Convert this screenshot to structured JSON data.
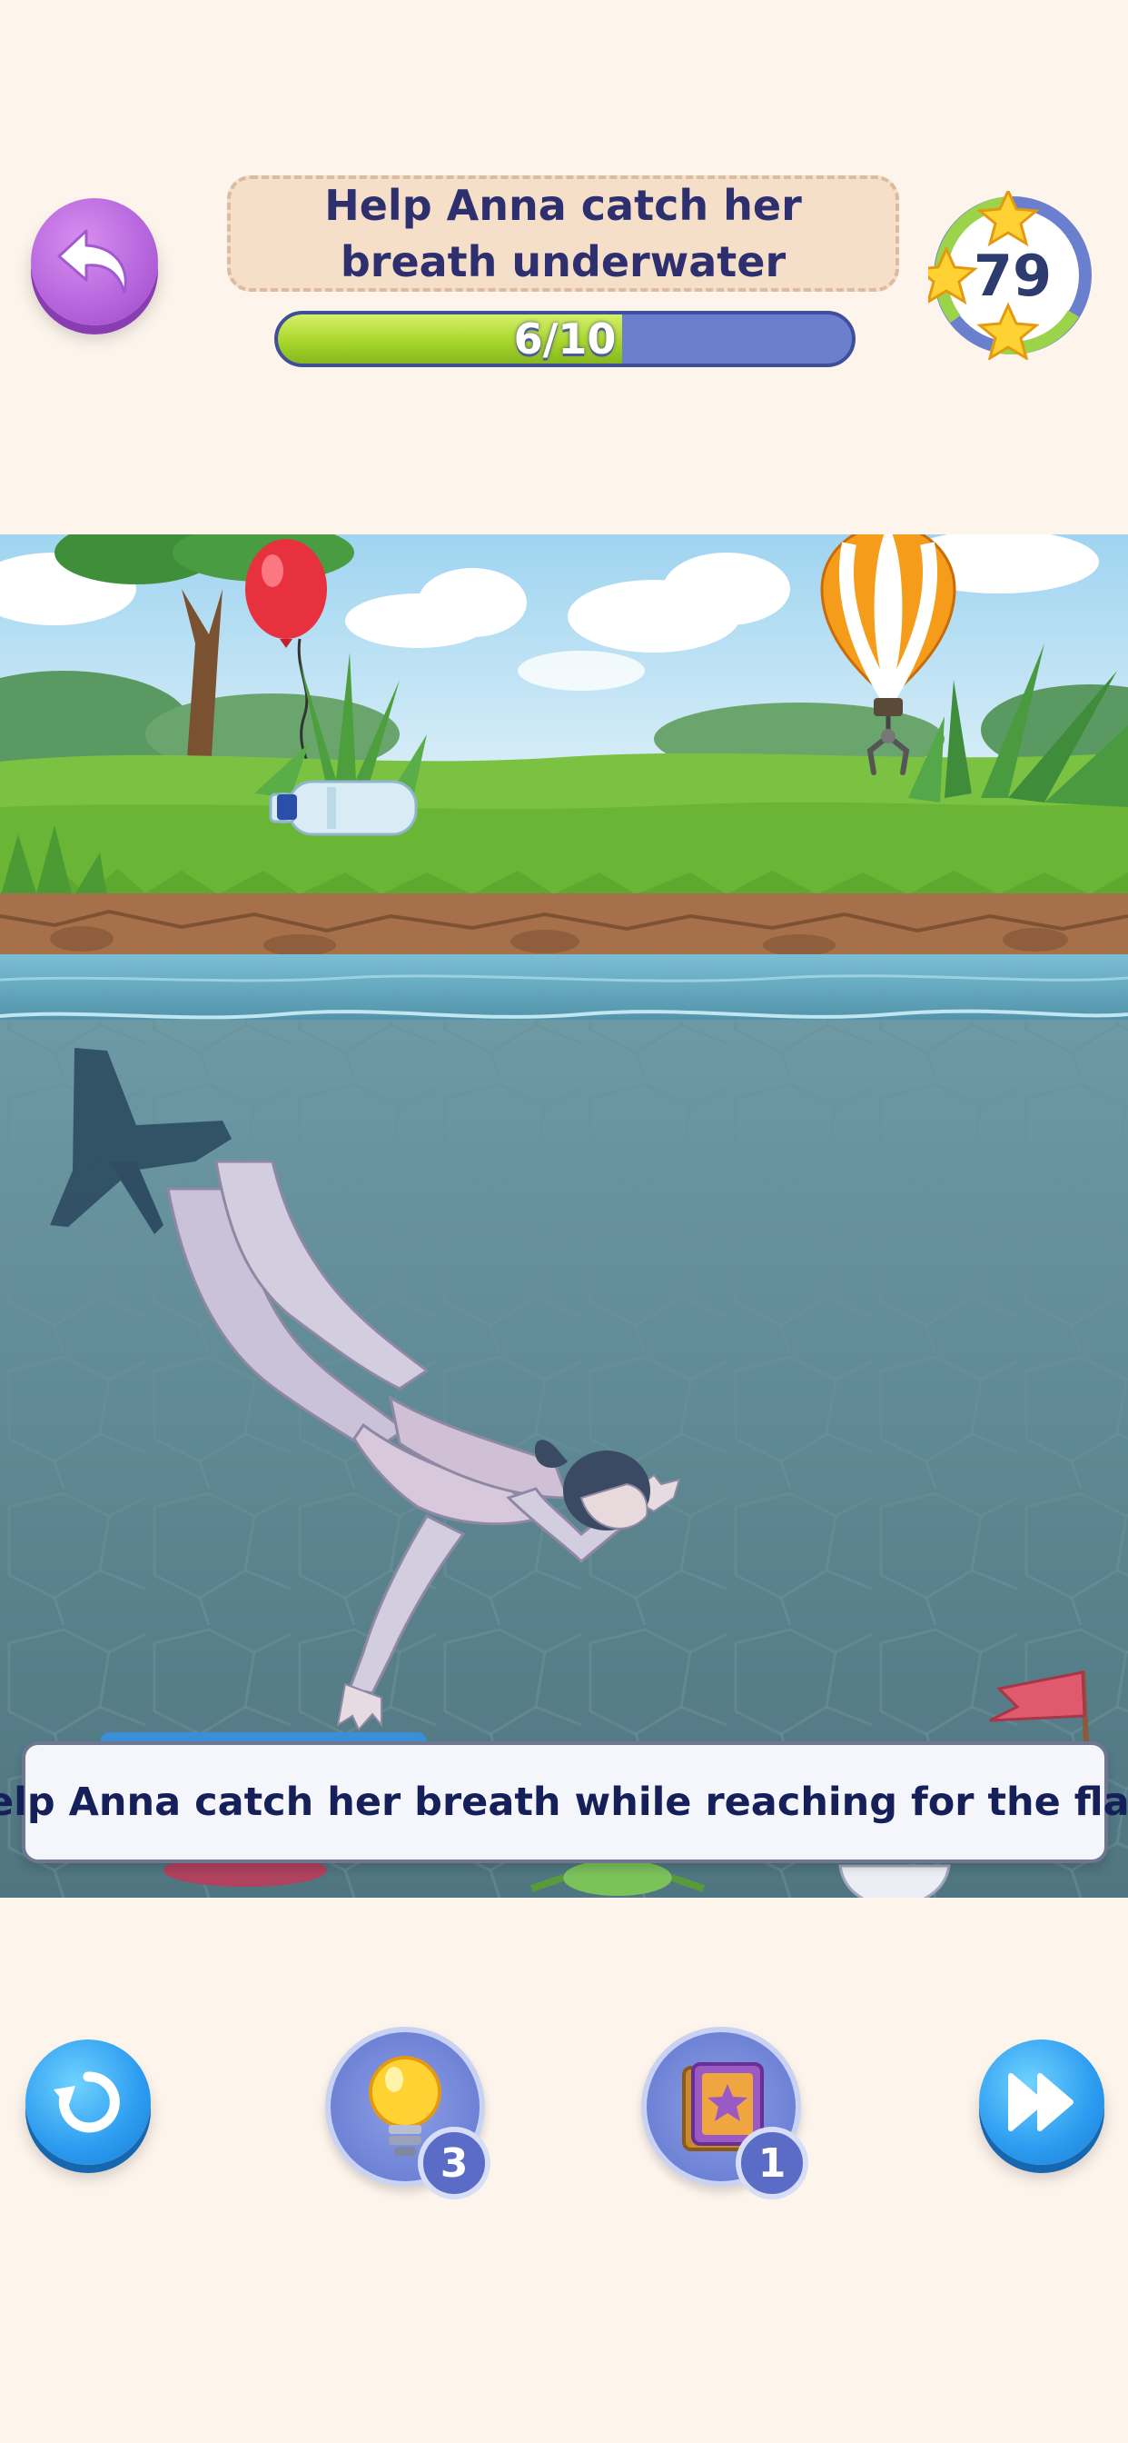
{
  "header": {
    "title": "Help Anna catch her breath underwater",
    "progress": {
      "label": "6/10",
      "current": 6,
      "total": 10
    },
    "stars": "79"
  },
  "scene": {
    "hint": "Help Anna catch her breath while reaching for the flag!"
  },
  "toolbar": {
    "hint_count": "3",
    "item_count": "1"
  },
  "colors": {
    "back_button": "#b564dc",
    "progress_fill": "#a8d62a",
    "progress_track": "#6b7fcf",
    "title_text": "#2d2f6e",
    "water": "#5f8793",
    "sky": "#bfe4f5",
    "grass": "#7cc242"
  },
  "icons": {
    "back": "curved-arrow-back-icon",
    "restart": "restart-icon",
    "hint": "lightbulb-icon",
    "item": "book-star-icon",
    "skip": "fast-forward-icon",
    "star": "star-icon"
  }
}
